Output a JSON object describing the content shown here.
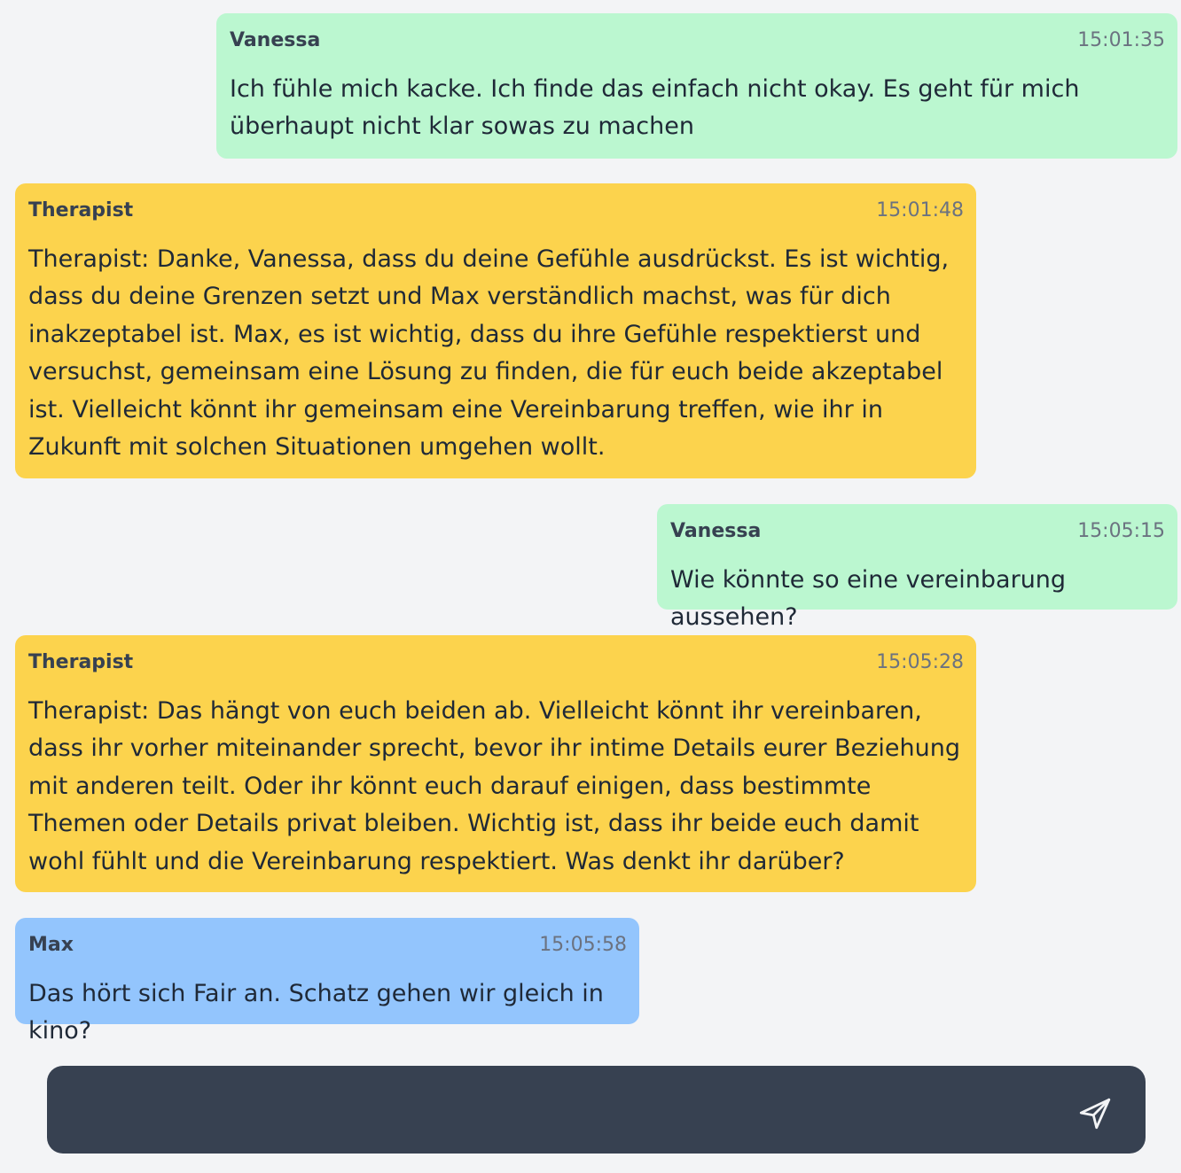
{
  "messages": [
    {
      "sender": "Vanessa",
      "time": "15:01:35",
      "text": "Ich fühle mich kacke. Ich finde das einfach nicht okay. Es geht für mich überhaupt nicht klar sowas zu machen"
    },
    {
      "sender": "Therapist",
      "time": "15:01:48",
      "text": "Therapist: Danke, Vanessa, dass du deine Gefühle ausdrückst. Es ist wichtig, dass du deine Grenzen setzt und Max verständlich machst, was für dich inakzeptabel ist. Max, es ist wichtig, dass du ihre Gefühle respektierst und versuchst, gemeinsam eine Lösung zu finden, die für euch beide akzeptabel ist. Vielleicht könnt ihr gemeinsam eine Vereinbarung treffen, wie ihr in Zukunft mit solchen Situationen umgehen wollt."
    },
    {
      "sender": "Vanessa",
      "time": "15:05:15",
      "text": "Wie könnte so eine vereinbarung aussehen?"
    },
    {
      "sender": "Therapist",
      "time": "15:05:28",
      "text": "Therapist: Das hängt von euch beiden ab. Vielleicht könnt ihr vereinbaren, dass ihr vorher miteinander sprecht, bevor ihr intime Details eurer Beziehung mit anderen teilt. Oder ihr könnt euch darauf einigen, dass bestimmte Themen oder Details privat bleiben. Wichtig ist, dass ihr beide euch damit wohl fühlt und die Vereinbarung respektiert. Was denkt ihr darüber?"
    },
    {
      "sender": "Max",
      "time": "15:05:58",
      "text": "Das hört sich Fair an. Schatz gehen wir gleich in kino?"
    }
  ],
  "composer": {
    "value": "",
    "placeholder": "",
    "send_icon": "paper-plane-icon"
  },
  "colors": {
    "vanessa": "#bbf7d0",
    "therapist": "#fcd34d",
    "max": "#93c5fd",
    "background": "#f3f4f6",
    "composer": "#374151"
  }
}
